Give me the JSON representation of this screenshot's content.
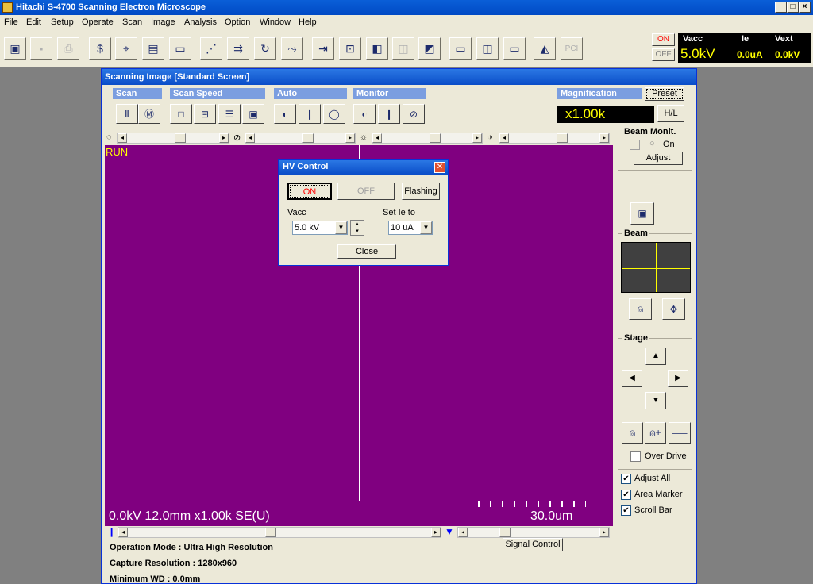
{
  "app": {
    "title": "Hitachi S-4700 Scanning Electron Microscope",
    "window_buttons": {
      "minimize": "_",
      "maximize": "□",
      "close": "×"
    }
  },
  "menu": [
    "File",
    "Edit",
    "Setup",
    "Operate",
    "Scan",
    "Image",
    "Analysis",
    "Option",
    "Window",
    "Help"
  ],
  "toolbar": {
    "on_label": "ON",
    "off_label": "OFF",
    "readout": {
      "vacc_label": "Vacc",
      "ie_label": "Ie",
      "vext_label": "Vext",
      "vacc_value": "5.0kV",
      "ie_value": "0.0uA",
      "vext_value": "0.0kV"
    }
  },
  "scan_window": {
    "title": "Scanning Image [Standard Screen]",
    "groups": {
      "scan": "Scan",
      "scan_speed": "Scan Speed",
      "auto": "Auto",
      "monitor": "Monitor",
      "magnification": "Magnification"
    },
    "preset_label": "Preset",
    "magnification_value": "x1.00k",
    "hl_label": "H/L",
    "run_label": "RUN",
    "image_info": "0.0kV 12.0mm x1.00k SE(U)",
    "scale_label": "30.0um",
    "signal_control_label": "Signal Control",
    "status_lines": [
      "Operation Mode : Ultra High Resolution",
      "Capture Resolution : 1280x960",
      "Minimum WD : 0.0mm"
    ],
    "beam_monit": {
      "title": "Beam Monit.",
      "on_label": "On",
      "adjust_label": "Adjust"
    },
    "beam_title": "Beam",
    "stage_title": "Stage",
    "over_drive_label": "Over Drive",
    "checkboxes": [
      {
        "label": "Adjust All",
        "checked": true
      },
      {
        "label": "Area Marker",
        "checked": true
      },
      {
        "label": "Scroll Bar",
        "checked": true
      }
    ]
  },
  "hv_dialog": {
    "title": "HV Control",
    "on_label": "ON",
    "off_label": "OFF",
    "flashing_label": "Flashing",
    "vacc_label": "Vacc",
    "vacc_value": "5.0 kV",
    "set_ie_label": "Set  Ie  to",
    "ie_value": "10 uA",
    "close_label": "Close"
  },
  "colors": {
    "sem_background": "#800080",
    "readout_text": "#ffff00",
    "on_text": "#ff0000"
  }
}
